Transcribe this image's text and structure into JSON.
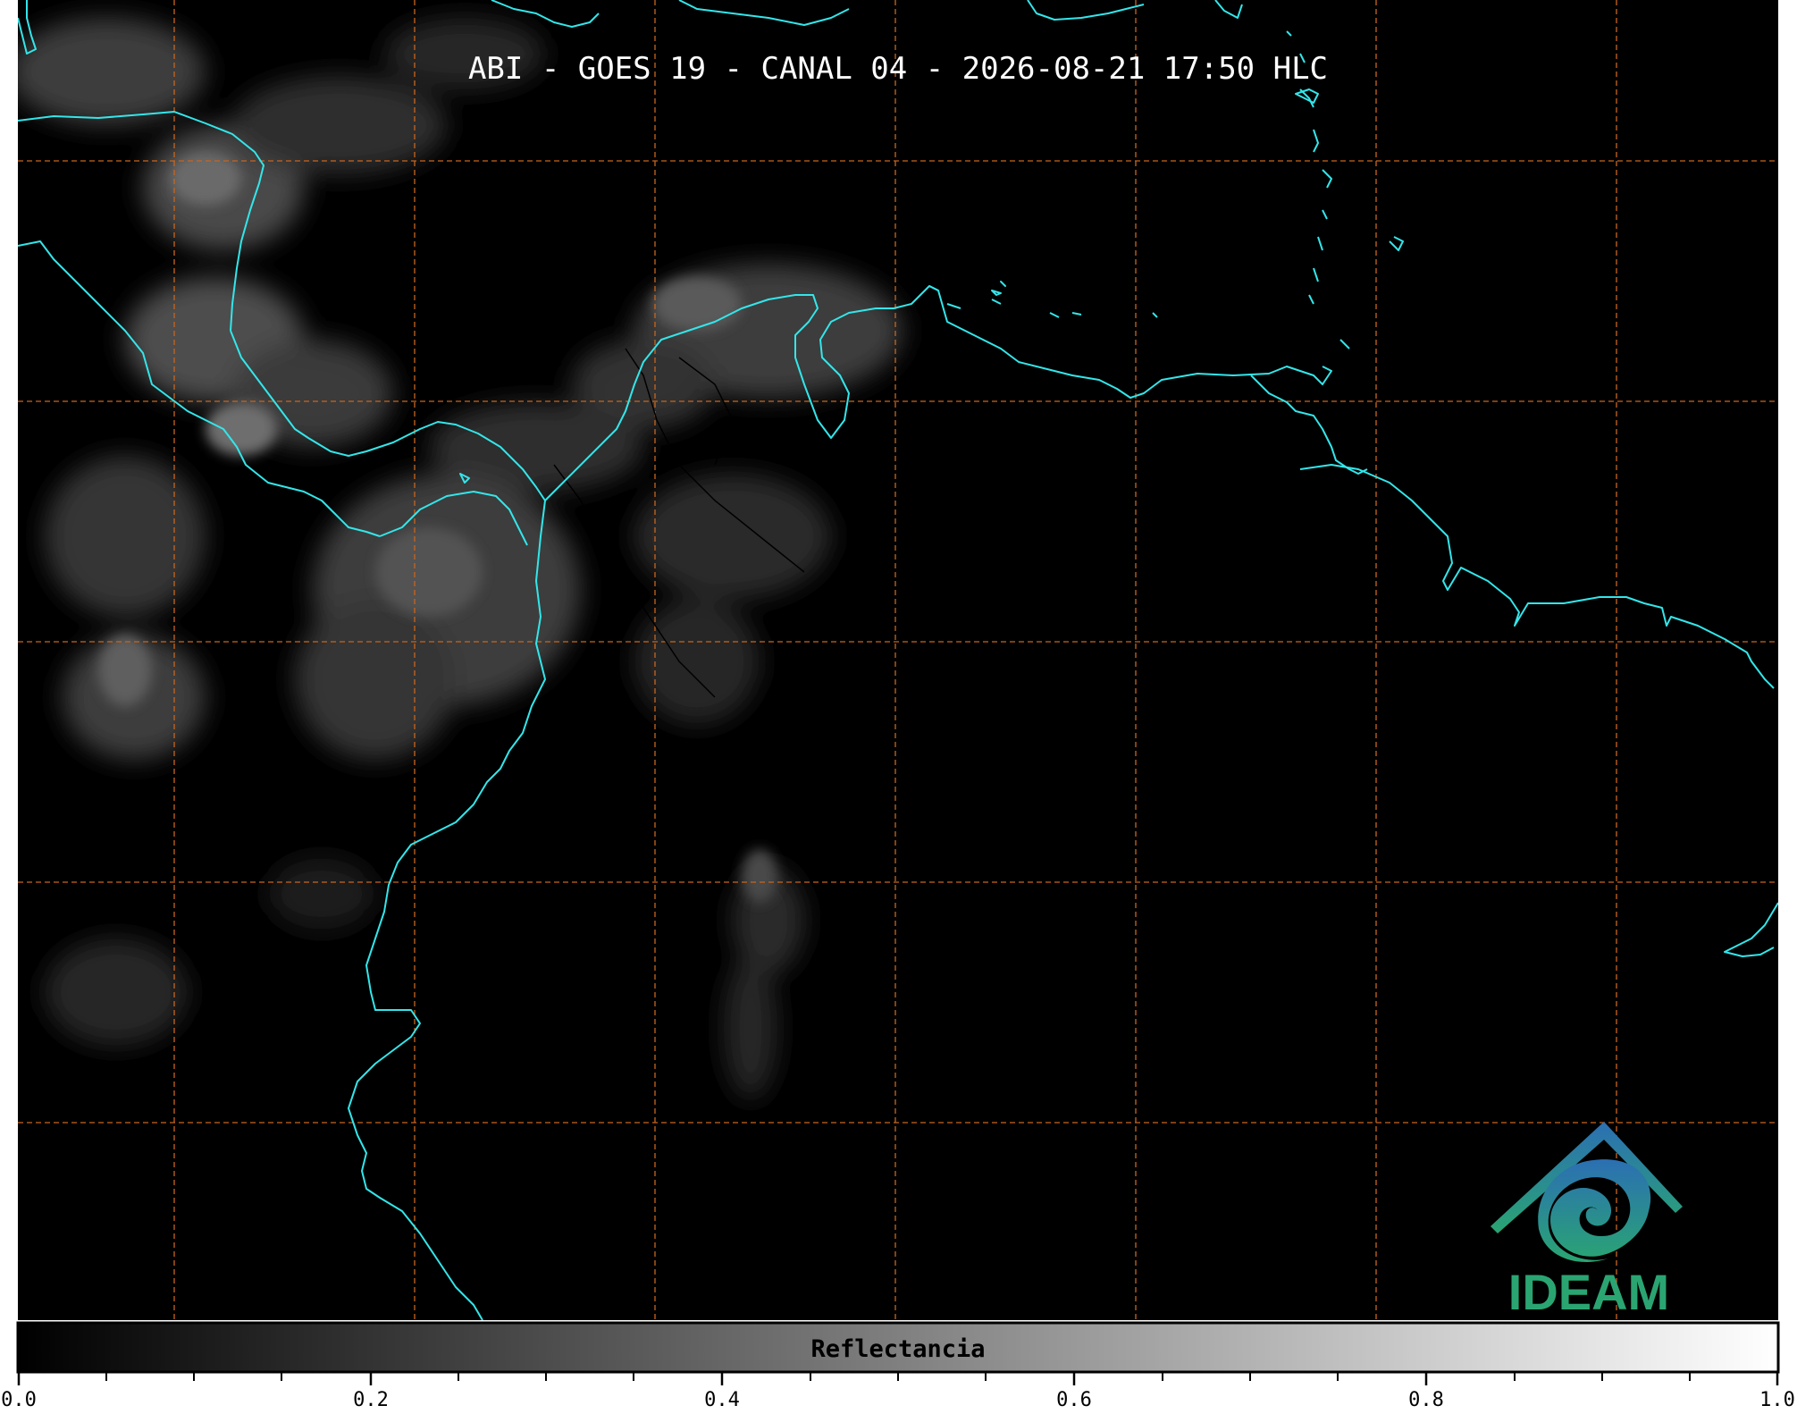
{
  "title": "ABI - GOES 19 - CANAL 04 - 2026-08-21 17:50 HLC",
  "colorbar": {
    "label": "Reflectancia",
    "ticks": [
      "0.0",
      "0.2",
      "0.4",
      "0.6",
      "0.8",
      "1.0"
    ],
    "range": [
      0.0,
      1.0
    ],
    "colormap": [
      "#000000",
      "#ffffff"
    ]
  },
  "map": {
    "background": "#000000",
    "coastline_color": "#33e6ea",
    "border_color": "#000000",
    "gridline_color": "#c8651e",
    "gridline_style": "dashed"
  },
  "logo": {
    "text": "IDEAM",
    "colors": [
      "#2b6fb3",
      "#2aa572"
    ]
  }
}
